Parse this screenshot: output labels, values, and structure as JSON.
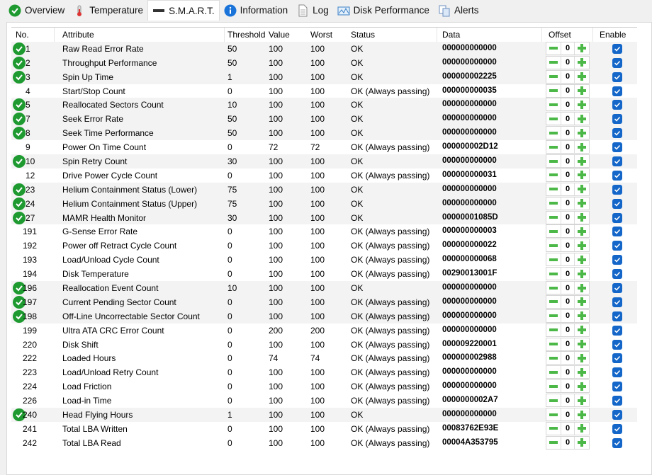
{
  "tabs": [
    {
      "label": "Overview",
      "icon": "check-circle-icon"
    },
    {
      "label": "Temperature",
      "icon": "thermometer-icon"
    },
    {
      "label": "S.M.A.R.T.",
      "icon": "drive-icon",
      "active": true
    },
    {
      "label": "Information",
      "icon": "info-icon"
    },
    {
      "label": "Log",
      "icon": "document-icon"
    },
    {
      "label": "Disk Performance",
      "icon": "chart-icon"
    },
    {
      "label": "Alerts",
      "icon": "alerts-icon"
    }
  ],
  "columns": {
    "no": "No.",
    "attribute": "Attribute",
    "threshold": "Threshold",
    "value": "Value",
    "worst": "Worst",
    "status": "Status",
    "data": "Data",
    "offset": "Offset",
    "enable": "Enable"
  },
  "rows": [
    [
      "1",
      "Raw Read Error Rate",
      "50",
      "100",
      "100",
      "OK",
      "000000000000",
      1
    ],
    [
      "2",
      "Throughput Performance",
      "50",
      "100",
      "100",
      "OK",
      "000000000000",
      1
    ],
    [
      "3",
      "Spin Up Time",
      "1",
      "100",
      "100",
      "OK",
      "000000002225",
      1
    ],
    [
      "4",
      "Start/Stop Count",
      "0",
      "100",
      "100",
      "OK (Always passing)",
      "000000000035",
      0
    ],
    [
      "5",
      "Reallocated Sectors Count",
      "10",
      "100",
      "100",
      "OK",
      "000000000000",
      1
    ],
    [
      "7",
      "Seek Error Rate",
      "50",
      "100",
      "100",
      "OK",
      "000000000000",
      1
    ],
    [
      "8",
      "Seek Time Performance",
      "50",
      "100",
      "100",
      "OK",
      "000000000000",
      1
    ],
    [
      "9",
      "Power On Time Count",
      "0",
      "72",
      "72",
      "OK (Always passing)",
      "000000002D12",
      0
    ],
    [
      "10",
      "Spin Retry Count",
      "30",
      "100",
      "100",
      "OK",
      "000000000000",
      1
    ],
    [
      "12",
      "Drive Power Cycle Count",
      "0",
      "100",
      "100",
      "OK (Always passing)",
      "000000000031",
      0
    ],
    [
      "23",
      "Helium Containment Status (Lower)",
      "75",
      "100",
      "100",
      "OK",
      "000000000000",
      1
    ],
    [
      "24",
      "Helium Containment Status (Upper)",
      "75",
      "100",
      "100",
      "OK",
      "000000000000",
      1
    ],
    [
      "27",
      "MAMR Health Monitor",
      "30",
      "100",
      "100",
      "OK",
      "00000001085D",
      1
    ],
    [
      "191",
      "G-Sense Error Rate",
      "0",
      "100",
      "100",
      "OK (Always passing)",
      "000000000003",
      0
    ],
    [
      "192",
      "Power off Retract Cycle Count",
      "0",
      "100",
      "100",
      "OK (Always passing)",
      "000000000022",
      0
    ],
    [
      "193",
      "Load/Unload Cycle Count",
      "0",
      "100",
      "100",
      "OK (Always passing)",
      "000000000068",
      0
    ],
    [
      "194",
      "Disk Temperature",
      "0",
      "100",
      "100",
      "OK (Always passing)",
      "00290013001F",
      0
    ],
    [
      "196",
      "Reallocation Event Count",
      "10",
      "100",
      "100",
      "OK",
      "000000000000",
      1
    ],
    [
      "197",
      "Current Pending Sector Count",
      "0",
      "100",
      "100",
      "OK (Always passing)",
      "000000000000",
      1
    ],
    [
      "198",
      "Off-Line Uncorrectable Sector Count",
      "0",
      "100",
      "100",
      "OK (Always passing)",
      "000000000000",
      1
    ],
    [
      "199",
      "Ultra ATA CRC Error Count",
      "0",
      "200",
      "200",
      "OK (Always passing)",
      "000000000000",
      0
    ],
    [
      "220",
      "Disk Shift",
      "0",
      "100",
      "100",
      "OK (Always passing)",
      "000009220001",
      0
    ],
    [
      "222",
      "Loaded Hours",
      "0",
      "74",
      "74",
      "OK (Always passing)",
      "000000002988",
      0
    ],
    [
      "223",
      "Load/Unload Retry Count",
      "0",
      "100",
      "100",
      "OK (Always passing)",
      "000000000000",
      0
    ],
    [
      "224",
      "Load Friction",
      "0",
      "100",
      "100",
      "OK (Always passing)",
      "000000000000",
      0
    ],
    [
      "226",
      "Load-in Time",
      "0",
      "100",
      "100",
      "OK (Always passing)",
      "0000000002A7",
      0
    ],
    [
      "240",
      "Head Flying Hours",
      "1",
      "100",
      "100",
      "OK",
      "000000000000",
      1
    ],
    [
      "241",
      "Total LBA Written",
      "0",
      "100",
      "100",
      "OK (Always passing)",
      "00083762E93E",
      0
    ],
    [
      "242",
      "Total LBA Read",
      "0",
      "100",
      "100",
      "OK (Always passing)",
      "00004A353795",
      0
    ]
  ],
  "offset_value": "0",
  "colors": {
    "ok": "#1e9a30",
    "enable": "#1467c9",
    "offset": "#4cb848"
  }
}
